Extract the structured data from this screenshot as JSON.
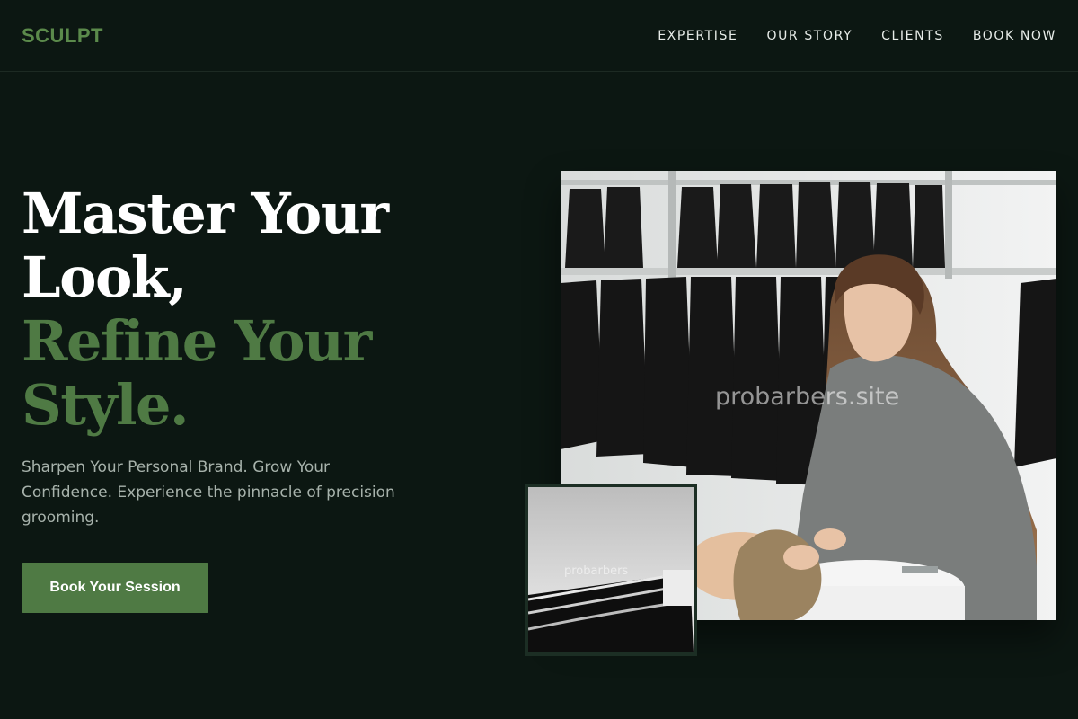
{
  "brand": {
    "logo": "SCULPT"
  },
  "nav": {
    "links": [
      "EXPERTISE",
      "OUR STORY",
      "CLIENTS",
      "BOOK NOW"
    ]
  },
  "hero": {
    "headline_line1": "Master Your",
    "headline_line2": "Look,",
    "headline_line3": "Refine Your",
    "headline_line4": "Style.",
    "subtitle": "Sharpen Your Personal Brand. Grow Your Confidence. Experience the pinnacle of precision grooming.",
    "cta_label": "Book Your Session"
  },
  "images": {
    "main_watermark": "probarbers.site",
    "thumb_watermark": "probarbers"
  },
  "colors": {
    "background": "#0c1712",
    "accent_green": "#4f7a44",
    "logo_green": "#5b8a4b",
    "subtitle_gray": "#a7b2ab"
  }
}
